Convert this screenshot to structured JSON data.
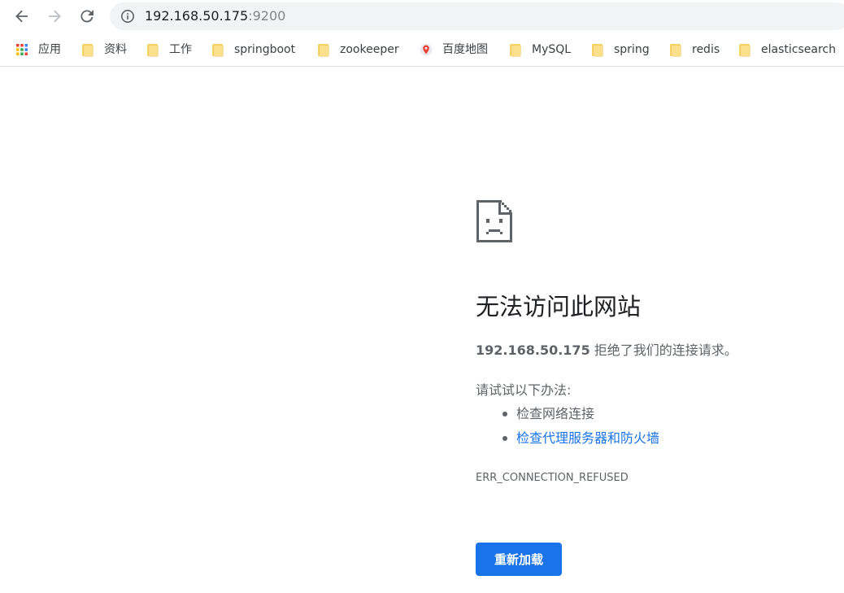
{
  "toolbar": {
    "back_icon": "back-arrow-icon",
    "forward_icon": "forward-arrow-icon",
    "reload_icon": "reload-icon",
    "info_icon": "info-icon",
    "url_host": "192.168.50.175",
    "url_port": ":9200"
  },
  "bookmarks": {
    "apps_label": "应用",
    "items": [
      {
        "label": "资料",
        "icon": "folder-icon"
      },
      {
        "label": "工作",
        "icon": "folder-icon"
      },
      {
        "label": "springboot",
        "icon": "folder-icon"
      },
      {
        "label": "zookeeper",
        "icon": "folder-icon"
      },
      {
        "label": "百度地图",
        "icon": "map-pin-icon"
      },
      {
        "label": "MySQL",
        "icon": "folder-icon"
      },
      {
        "label": "spring",
        "icon": "folder-icon"
      },
      {
        "label": "redis",
        "icon": "folder-icon"
      },
      {
        "label": "elasticsearch",
        "icon": "folder-icon"
      }
    ]
  },
  "error": {
    "icon": "sad-page-icon",
    "title": "无法访问此网站",
    "host": "192.168.50.175",
    "message": " 拒绝了我们的连接请求。",
    "suggestions_title": "请试试以下办法:",
    "suggestions": [
      {
        "label": "检查网络连接"
      },
      {
        "label": "检查代理服务器和防火墙"
      }
    ],
    "code": "ERR_CONNECTION_REFUSED",
    "reload_label": "重新加载"
  },
  "colors": {
    "accent": "#1a73e8",
    "text_primary": "#202124",
    "text_secondary": "#5f6368",
    "omnibox_bg": "#f1f3f4",
    "folder": "#f7d66b"
  }
}
